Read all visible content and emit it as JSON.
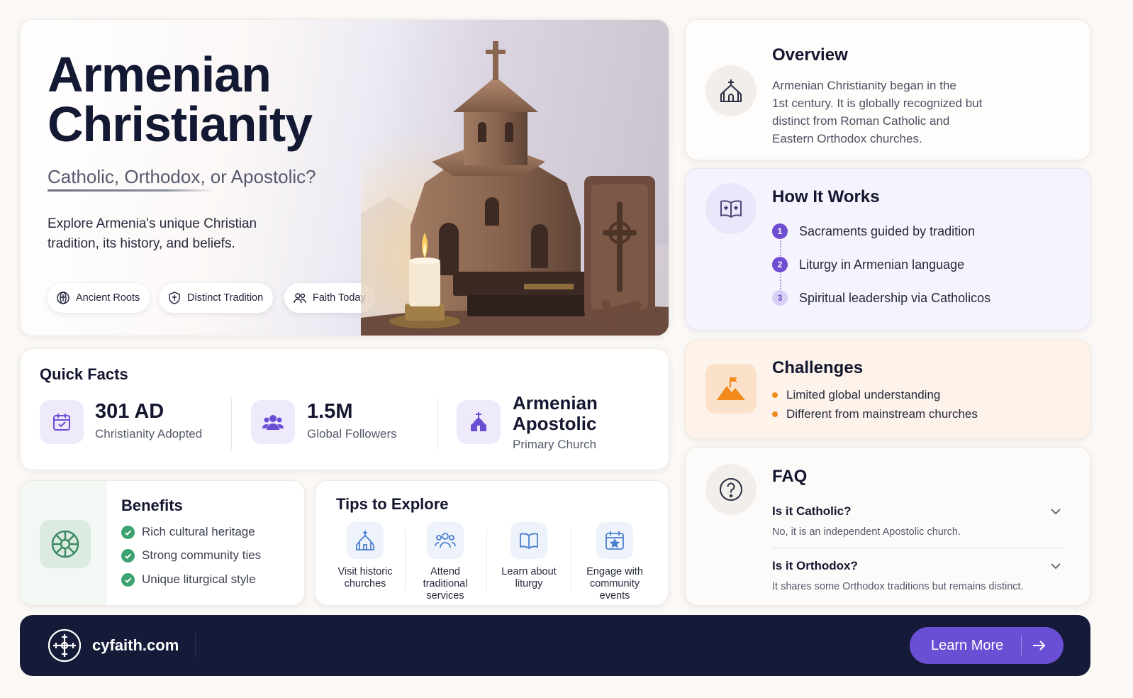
{
  "hero": {
    "title_line1": "Armenian",
    "title_line2": "Christianity",
    "subtitle": "Catholic, Orthodox, or Apostolic?",
    "description": "Explore Armenia's unique Christian tradition, its history, and beliefs.",
    "pills": [
      {
        "label": "Ancient Roots",
        "icon": "globe-cross-icon"
      },
      {
        "label": "Distinct Tradition",
        "icon": "shield-cross-icon"
      },
      {
        "label": "Faith Today",
        "icon": "people-icon"
      }
    ],
    "image_alt": "Stone Armenian church model with lit candle, books and khachkar cross-stone"
  },
  "quick_facts": {
    "title": "Quick Facts",
    "items": [
      {
        "value": "301 AD",
        "label": "Christianity Adopted",
        "icon": "calendar-icon"
      },
      {
        "value": "1.5M",
        "label": "Global Followers",
        "icon": "users-icon"
      },
      {
        "value_line1": "Armenian",
        "value_line2": "Apostolic",
        "label": "Primary Church",
        "icon": "church-icon"
      }
    ]
  },
  "benefits": {
    "title": "Benefits",
    "items": [
      "Rich cultural heritage",
      "Strong community ties",
      "Unique liturgical style"
    ],
    "icon": "armenian-cross-emblem-icon"
  },
  "tips": {
    "title": "Tips to Explore",
    "items": [
      {
        "line1": "Visit historic",
        "line2": "churches",
        "line3": "",
        "icon": "church-icon"
      },
      {
        "line1": "Attend",
        "line2": "traditional",
        "line3": "services",
        "icon": "group-icon"
      },
      {
        "line1": "Learn about",
        "line2": "liturgy",
        "line3": "",
        "icon": "open-book-icon"
      },
      {
        "line1": "Engage with",
        "line2": "community",
        "line3": "events",
        "icon": "calendar-star-icon"
      }
    ]
  },
  "overview": {
    "title": "Overview",
    "lines": [
      "Armenian Christianity began in the",
      "1st century. It is globally recognized but",
      "distinct from Roman Catholic and",
      "Eastern Orthodox churches."
    ]
  },
  "how_it_works": {
    "title": "How It Works",
    "steps": [
      {
        "num": "1",
        "text": "Sacraments guided by tradition"
      },
      {
        "num": "2",
        "text": "Liturgy in Armenian language"
      },
      {
        "num": "3",
        "text": "Spiritual leadership via Catholicos"
      }
    ]
  },
  "challenges": {
    "title": "Challenges",
    "items": [
      "Limited global understanding",
      "Different from mainstream churches"
    ]
  },
  "faq": {
    "title": "FAQ",
    "items": [
      {
        "question": "Is it Catholic?",
        "answer": "No, it is an independent Apostolic church."
      },
      {
        "question": "Is it Orthodox?",
        "answer": "It shares some Orthodox traditions but remains distinct."
      }
    ]
  },
  "footer": {
    "site": "cyfaith.com",
    "cta": "Learn More"
  },
  "colors": {
    "accent": "#6a4fd4",
    "navy": "#141a37",
    "green": "#3aa370",
    "orange": "#f28a1c"
  }
}
